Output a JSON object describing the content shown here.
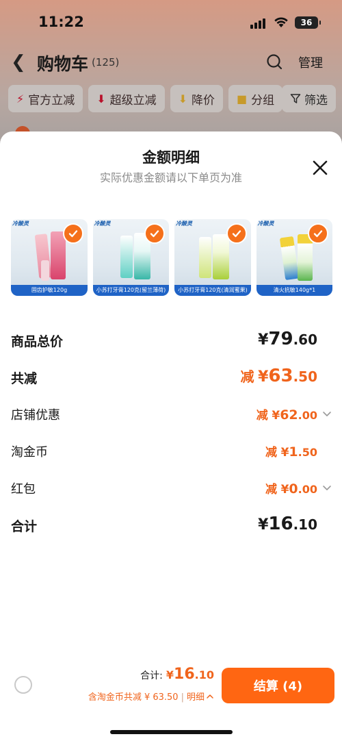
{
  "status_bar": {
    "time": "11:22",
    "battery": "36"
  },
  "nav": {
    "title": "购物车",
    "count": "(125)",
    "manage": "管理"
  },
  "filters": [
    {
      "label": "官方立减",
      "icon": "lightning-icon"
    },
    {
      "label": "超级立减",
      "icon": "arrow-down-icon"
    },
    {
      "label": "降价",
      "icon": "price-down-icon"
    },
    {
      "label": "分组",
      "icon": "folder-icon"
    }
  ],
  "filter_button": "筛选",
  "sheet": {
    "title": "金额明细",
    "subtitle": "实际优惠金额请以下单页为准"
  },
  "products": [
    {
      "brand": "冷酸灵",
      "caption": "固齿护敏120g",
      "selected": true
    },
    {
      "brand": "冷酸灵",
      "caption": "小苏打牙膏120克(留兰薄荷)",
      "selected": true
    },
    {
      "brand": "冷酸灵",
      "caption": "小苏打牙膏120克(清润蜜果)",
      "selected": true
    },
    {
      "brand": "冷酸灵",
      "caption": "清火抗敏140g*1",
      "selected": true
    }
  ],
  "breakdown": {
    "subtotal": {
      "label": "商品总价",
      "prefix": "",
      "yen": "¥",
      "int": "79",
      "dec": ".60"
    },
    "total_discount": {
      "label": "共减",
      "prefix": "减",
      "yen": "¥",
      "int": "63",
      "dec": ".50"
    },
    "store_discount": {
      "label": "店铺优惠",
      "prefix": "减",
      "yen": "¥",
      "int": "62",
      "dec": ".00"
    },
    "coins": {
      "label": "淘金币",
      "prefix": "减",
      "yen": "¥",
      "int": "1",
      "dec": ".50"
    },
    "red_packet": {
      "label": "红包",
      "prefix": "减",
      "yen": "¥",
      "int": "0",
      "dec": ".00"
    },
    "total": {
      "label": "合计",
      "prefix": "",
      "yen": "¥",
      "int": "16",
      "dec": ".10"
    }
  },
  "bottom_bar": {
    "total_label": "合计:",
    "total_yen": "¥",
    "total_int": "16",
    "total_dec": ".10",
    "discount_text": "含淘金币共减 ¥ 63.50",
    "separator": "|",
    "detail_link": "明细",
    "checkout": "结算 (4)"
  },
  "colors": {
    "accent": "#ff6612",
    "discount": "#f0641c",
    "product_caption": "#1f63c6"
  }
}
